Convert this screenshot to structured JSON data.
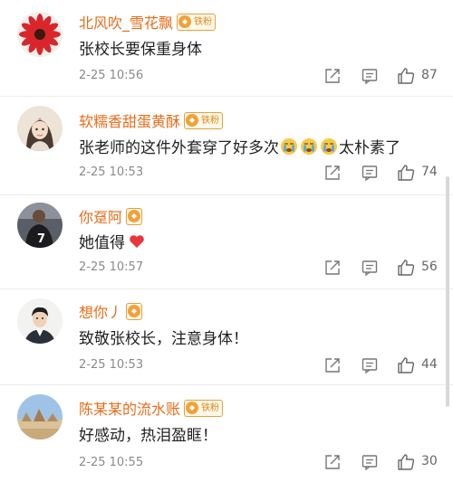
{
  "comments": [
    {
      "username": "北风吹_雪花飘",
      "badge": "铁粉",
      "text": "张校长要保重身体",
      "time": "2-25 10:56",
      "likes": "87"
    },
    {
      "username": "软糯香甜蛋黄酥",
      "badge": "铁粉",
      "text_before": "张老师的这件外套穿了好多次",
      "text_after": "太朴素了",
      "time": "2-25 10:53",
      "likes": "74"
    },
    {
      "username": "你趸阿",
      "badge": "",
      "text": "她值得",
      "time": "2-25 10:57",
      "likes": "56"
    },
    {
      "username": "想你丿",
      "badge": "",
      "text": "致敬张校长，注意身体！",
      "time": "2-25 10:53",
      "likes": "44"
    },
    {
      "username": "陈某某的流水账",
      "badge": "铁粉",
      "text": "好感动，热泪盈眶！",
      "time": "2-25 10:55",
      "likes": "30"
    }
  ],
  "colors": {
    "username": "#e86c1a",
    "heart": "#e8363c",
    "badge_border": "#e3a23d"
  },
  "icons": {
    "share": "share-icon",
    "comment": "comment-icon",
    "like": "thumbs-up-icon",
    "emoji": "crying-emoji",
    "heart": "heart-emoji"
  }
}
